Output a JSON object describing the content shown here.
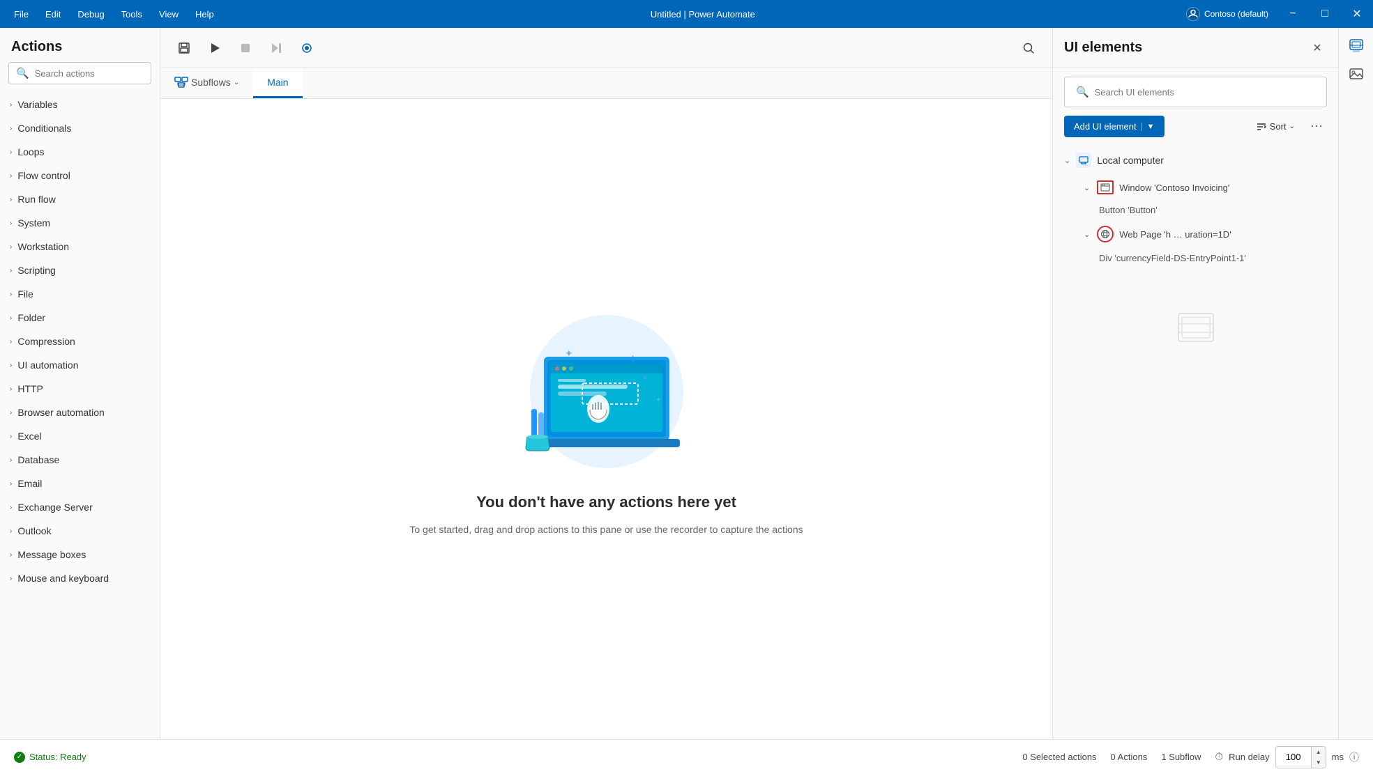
{
  "titlebar": {
    "menus": [
      "File",
      "Edit",
      "Debug",
      "Tools",
      "View",
      "Help"
    ],
    "title": "Untitled | Power Automate",
    "user": "Contoso (default)",
    "controls": [
      "minimize",
      "maximize",
      "close"
    ]
  },
  "actions_panel": {
    "header": "Actions",
    "search_placeholder": "Search actions",
    "groups": [
      "Variables",
      "Conditionals",
      "Loops",
      "Flow control",
      "Run flow",
      "System",
      "Workstation",
      "Scripting",
      "File",
      "Folder",
      "Compression",
      "UI automation",
      "HTTP",
      "Browser automation",
      "Excel",
      "Database",
      "Email",
      "Exchange Server",
      "Outlook",
      "Message boxes",
      "Mouse and keyboard"
    ]
  },
  "canvas": {
    "toolbar_buttons": [
      "save",
      "run",
      "stop",
      "step",
      "record"
    ],
    "tabs": [
      {
        "id": "subflows",
        "label": "Subflows",
        "active": false
      },
      {
        "id": "main",
        "label": "Main",
        "active": true
      }
    ],
    "empty_title": "You don't have any actions here yet",
    "empty_subtitle": "To get started, drag and drop actions to this pane\nor use the recorder to capture the actions"
  },
  "ui_elements_panel": {
    "title": "UI elements",
    "search_placeholder": "Search UI elements",
    "add_button_label": "Add UI element",
    "sort_label": "Sort",
    "tree": {
      "local_computer": {
        "label": "Local computer",
        "expanded": true,
        "children": [
          {
            "label": "Window 'Contoso Invoicing'",
            "expanded": true,
            "children": [
              {
                "label": "Button 'Button'"
              }
            ]
          },
          {
            "label": "Web Page 'h … uration=1D'",
            "expanded": true,
            "children": [
              {
                "label": "Div 'currencyField-DS-EntryPoint1-1'"
              }
            ]
          }
        ]
      }
    }
  },
  "statusbar": {
    "status": "Status: Ready",
    "selected_actions": "0 Selected actions",
    "actions_count": "0 Actions",
    "subflow_count": "1 Subflow",
    "run_delay_label": "Run delay",
    "run_delay_value": "100",
    "run_delay_unit": "ms"
  }
}
